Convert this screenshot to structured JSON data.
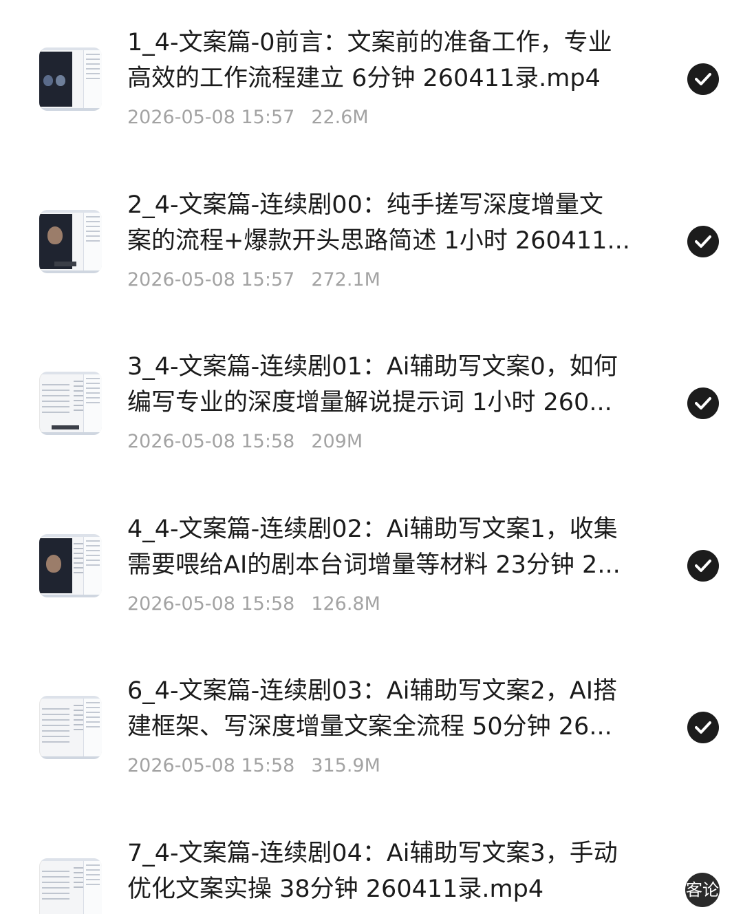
{
  "files": [
    {
      "title_line1": "1_4-文案篇-0前言：文案前的准备工作，专业",
      "title_line2": "高效的工作流程建立 6分钟 260411录.mp4",
      "date": "2026-05-08 15:57",
      "size": "22.6M",
      "checked": true,
      "thumbnail_icon": "video-thumbnail-icon"
    },
    {
      "title_line1": "2_4-文案篇-连续剧00：纯手搓写深度增量文",
      "title_line2": "案的流程+爆款开头思路简述 1小时 260411...",
      "date": "2026-05-08 15:57",
      "size": "272.1M",
      "checked": true,
      "thumbnail_icon": "video-thumbnail-icon"
    },
    {
      "title_line1": "3_4-文案篇-连续剧01：Ai辅助写文案0，如何",
      "title_line2": "编写专业的深度增量解说提示词 1小时 260...",
      "date": "2026-05-08 15:58",
      "size": "209M",
      "checked": true,
      "thumbnail_icon": "video-thumbnail-icon"
    },
    {
      "title_line1": "4_4-文案篇-连续剧02：Ai辅助写文案1，收集",
      "title_line2": "需要喂给AI的剧本台词增量等材料 23分钟 2...",
      "date": "2026-05-08 15:58",
      "size": "126.8M",
      "checked": true,
      "thumbnail_icon": "video-thumbnail-icon"
    },
    {
      "title_line1": "6_4-文案篇-连续剧03：Ai辅助写文案2，AI搭",
      "title_line2": "建框架、写深度增量文案全流程 50分钟 26...",
      "date": "2026-05-08 15:58",
      "size": "315.9M",
      "checked": true,
      "thumbnail_icon": "video-thumbnail-icon"
    },
    {
      "title_line1": "7_4-文案篇-连续剧04：Ai辅助写文案3，手动",
      "title_line2": "优化文案实操 38分钟 260411录.mp4",
      "date": "",
      "size": "",
      "checked": false,
      "thumbnail_icon": "video-thumbnail-icon"
    }
  ],
  "watermark": {
    "text": "客论"
  },
  "colors": {
    "title": "#1b1b1b",
    "meta": "#a3a3a3",
    "check_bg": "#1c1c1c",
    "check_mark": "#ffffff",
    "background": "#ffffff"
  }
}
